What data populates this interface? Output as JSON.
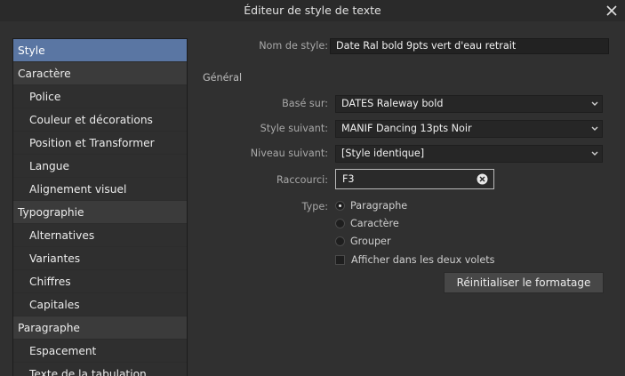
{
  "window": {
    "title": "Éditeur de style de texte",
    "close_icon": "close-icon"
  },
  "sidebar": {
    "items": [
      {
        "label": "Style",
        "kind": "category",
        "selected": true
      },
      {
        "label": "Caractère",
        "kind": "category"
      },
      {
        "label": "Police",
        "kind": "sub"
      },
      {
        "label": "Couleur et décorations",
        "kind": "sub"
      },
      {
        "label": "Position et Transformer",
        "kind": "sub"
      },
      {
        "label": "Langue",
        "kind": "sub"
      },
      {
        "label": "Alignement visuel",
        "kind": "sub"
      },
      {
        "label": "Typographie",
        "kind": "category"
      },
      {
        "label": "Alternatives",
        "kind": "sub"
      },
      {
        "label": "Variantes",
        "kind": "sub"
      },
      {
        "label": "Chiffres",
        "kind": "sub"
      },
      {
        "label": "Capitales",
        "kind": "sub"
      },
      {
        "label": "Paragraphe",
        "kind": "category"
      },
      {
        "label": "Espacement",
        "kind": "sub"
      },
      {
        "label": "Texte de la tabulation",
        "kind": "sub"
      }
    ]
  },
  "form": {
    "style_name_label": "Nom de style:",
    "style_name_value": "Date Ral bold 9pts vert d'eau retrait",
    "section_title": "Général",
    "based_on_label": "Basé sur:",
    "based_on_value": "DATES Raleway bold",
    "next_style_label": "Style suivant:",
    "next_style_value": "MANIF Dancing 13pts Noir",
    "next_level_label": "Niveau suivant:",
    "next_level_value": "[Style identique]",
    "shortcut_label": "Raccourci:",
    "shortcut_value": "F3",
    "type_label": "Type:",
    "type_options": [
      {
        "label": "Paragraphe",
        "checked": true
      },
      {
        "label": "Caractère",
        "checked": false
      },
      {
        "label": "Grouper",
        "checked": false
      }
    ],
    "show_both_panels_label": "Afficher dans les deux volets",
    "show_both_panels_checked": false,
    "reset_button_label": "Réinitialiser le formatage"
  },
  "colors": {
    "background": "#303030",
    "selection": "#5a76a3",
    "field": "#222222"
  }
}
